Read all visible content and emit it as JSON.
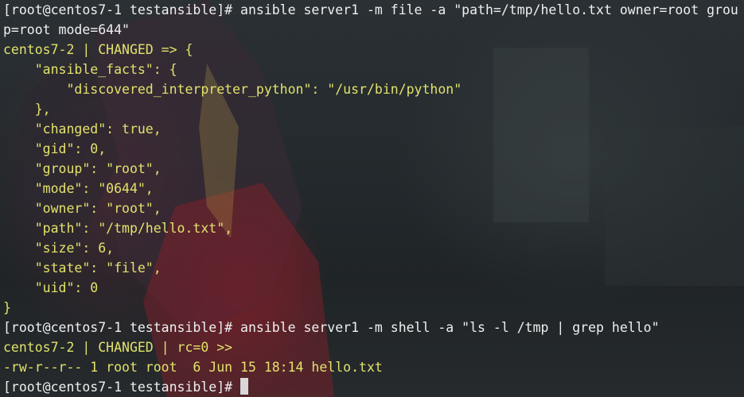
{
  "terminal": {
    "lines": [
      {
        "text": "[root@centos7-1 testansible]# ansible server1 -m file -a \"path=/tmp/hello.txt owner=root grou",
        "color": "white"
      },
      {
        "text": "p=root mode=644\"",
        "color": "white"
      },
      {
        "text": "centos7-2 | CHANGED => {",
        "color": "yellow"
      },
      {
        "text": "    \"ansible_facts\": {",
        "color": "yellow"
      },
      {
        "text": "        \"discovered_interpreter_python\": \"/usr/bin/python\"",
        "color": "yellow"
      },
      {
        "text": "    },",
        "color": "yellow"
      },
      {
        "text": "    \"changed\": true,",
        "color": "yellow"
      },
      {
        "text": "    \"gid\": 0,",
        "color": "yellow"
      },
      {
        "text": "    \"group\": \"root\",",
        "color": "yellow"
      },
      {
        "text": "    \"mode\": \"0644\",",
        "color": "yellow"
      },
      {
        "text": "    \"owner\": \"root\",",
        "color": "yellow"
      },
      {
        "text": "    \"path\": \"/tmp/hello.txt\",",
        "color": "yellow"
      },
      {
        "text": "    \"size\": 6,",
        "color": "yellow"
      },
      {
        "text": "    \"state\": \"file\",",
        "color": "yellow"
      },
      {
        "text": "    \"uid\": 0",
        "color": "yellow"
      },
      {
        "text": "}",
        "color": "yellow"
      },
      {
        "text": "[root@centos7-1 testansible]# ansible server1 -m shell -a \"ls -l /tmp | grep hello\"",
        "color": "white"
      },
      {
        "text": "centos7-2 | CHANGED | rc=0 >>",
        "color": "yellow"
      },
      {
        "text": "-rw-r--r-- 1 root root  6 Jun 15 18:14 hello.txt",
        "color": "yellow"
      },
      {
        "text": "[root@centos7-1 testansible]# ",
        "color": "white",
        "cursor": true
      }
    ]
  },
  "colors": {
    "prompt": "#eef0f0",
    "output": "#e2e26c",
    "cursor": "#d8d8d8"
  }
}
